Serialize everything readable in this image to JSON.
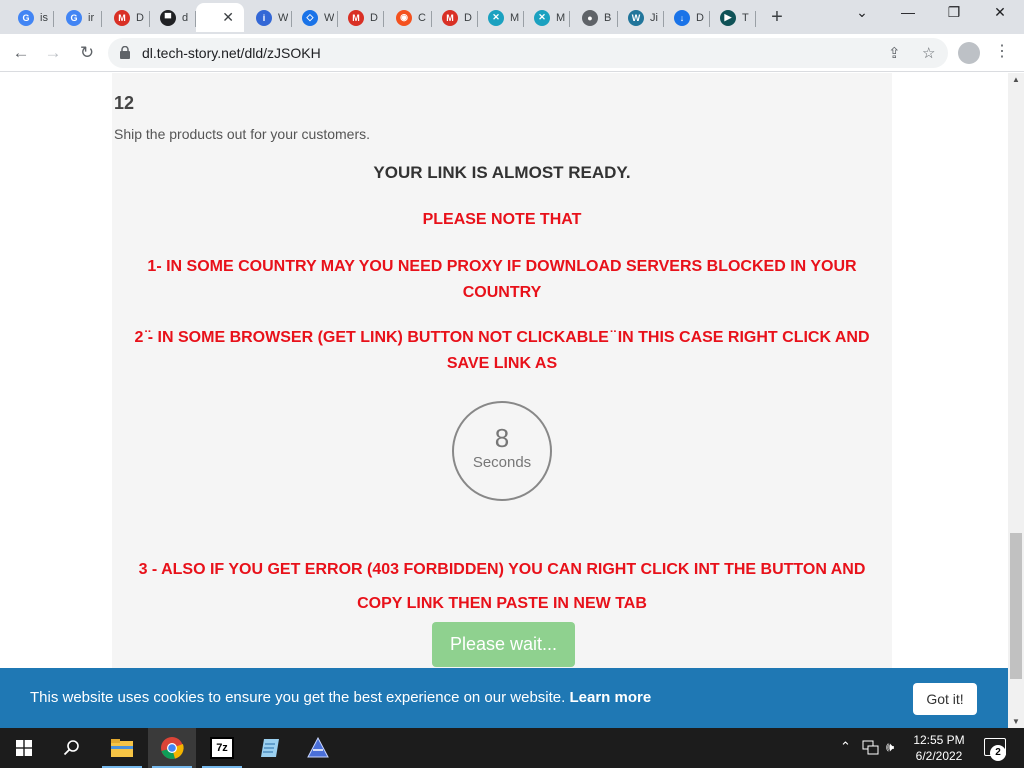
{
  "browser": {
    "tabs": [
      {
        "letter": "G",
        "title": "is",
        "color": "#4285f4"
      },
      {
        "letter": "G",
        "title": "ir",
        "color": "#4285f4"
      },
      {
        "letter": "M",
        "title": "D",
        "color": "#d93025"
      },
      {
        "letter": "▀",
        "title": "d",
        "color": "#202124"
      },
      {
        "letter": "",
        "title": "",
        "color": "#ffffff",
        "active": true
      },
      {
        "letter": "i",
        "title": "W",
        "color": "#3367d6"
      },
      {
        "letter": "◇",
        "title": "W",
        "color": "#1a73e8"
      },
      {
        "letter": "M",
        "title": "D",
        "color": "#d93025"
      },
      {
        "letter": "◉",
        "title": "C",
        "color": "#f4511e"
      },
      {
        "letter": "M",
        "title": "D",
        "color": "#d93025"
      },
      {
        "letter": "✕",
        "title": "M",
        "color": "#1ba1c0"
      },
      {
        "letter": "✕",
        "title": "M",
        "color": "#1ba1c0"
      },
      {
        "letter": "●",
        "title": "B",
        "color": "#5f6368"
      },
      {
        "letter": "W",
        "title": "Ji",
        "color": "#21759b"
      },
      {
        "letter": "↓",
        "title": "D",
        "color": "#1a73e8"
      },
      {
        "letter": "▶",
        "title": "T",
        "color": "#0f5257"
      }
    ],
    "url": "dl.tech-story.net/dld/zJSOKH"
  },
  "page": {
    "step_number": "12",
    "step_desc": "Ship the products out for your customers.",
    "heading": "YOUR LINK IS ALMOST READY.",
    "note_title": "PLEASE NOTE THAT",
    "note1": "1- IN SOME COUNTRY MAY YOU NEED PROXY IF DOWNLOAD SERVERS BLOCKED IN YOUR COUNTRY",
    "note2": "2 ̈- IN SOME BROWSER (GET LINK) BUTTON NOT CLICKABLE ̈  IN THIS CASE RIGHT CLICK AND SAVE LINK AS",
    "countdown_value": "8",
    "countdown_label": "Seconds",
    "note3_line1": "3 - ALSO IF YOU GET ERROR (403 FORBIDDEN) YOU CAN RIGHT CLICK INT THE BUTTON AND",
    "note3_line2": "COPY LINK THEN PASTE IN NEW TAB",
    "wait_button": "Please wait..."
  },
  "cookie": {
    "text": "This website uses cookies to ensure you get the best experience on our website.",
    "link": "Learn more",
    "button": "Got it!"
  },
  "taskbar": {
    "time": "12:55 PM",
    "date": "6/2/2022",
    "notifications": "2"
  },
  "colors": {
    "accent_red": "#e8111a",
    "cookie_bg": "#1f78b4",
    "wait_button_bg": "#8fd18f"
  }
}
